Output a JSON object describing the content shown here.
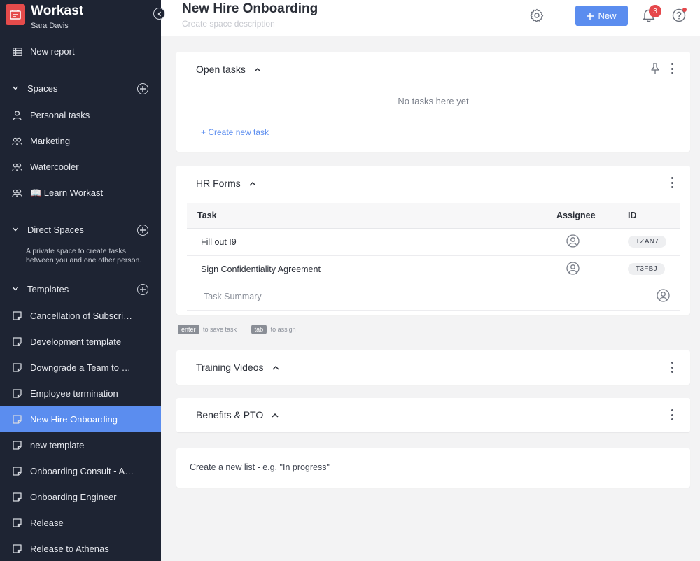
{
  "app": {
    "name": "Workast",
    "user": "Sara Davis"
  },
  "sidebar": {
    "new_report": "New report",
    "spaces": {
      "label": "Spaces",
      "items": [
        {
          "label": "Personal tasks",
          "icon": "person-icon"
        },
        {
          "label": "Marketing",
          "icon": "people-icon"
        },
        {
          "label": "Watercooler",
          "icon": "people-icon"
        },
        {
          "label": "📖 Learn Workast",
          "icon": "people-icon"
        }
      ]
    },
    "direct_spaces": {
      "label": "Direct Spaces",
      "note": "A private space to create tasks between you and one other person."
    },
    "templates": {
      "label": "Templates",
      "items": [
        "Cancellation of Subscription",
        "Development template",
        "Downgrade a Team to Free",
        "Employee termination",
        "New Hire Onboarding",
        "new template",
        "Onboarding Consult - Account",
        "Onboarding Engineer",
        "Release",
        "Release to Athenas"
      ],
      "active": "New Hire Onboarding"
    }
  },
  "header": {
    "title": "New Hire Onboarding",
    "description_placeholder": "Create space description",
    "new_button": "New",
    "notification_count": "3"
  },
  "lists": {
    "open_tasks": {
      "title": "Open tasks",
      "empty": "No tasks here yet",
      "create": "+ Create new task"
    },
    "hr_forms": {
      "title": "HR Forms",
      "columns": {
        "task": "Task",
        "assignee": "Assignee",
        "id": "ID"
      },
      "rows": [
        {
          "task": "Fill out I9",
          "id": "TZAN7"
        },
        {
          "task": "Sign Confidentiality Agreement",
          "id": "T3FBJ"
        }
      ],
      "summary_placeholder": "Task Summary"
    },
    "hints": {
      "enter_key": "enter",
      "enter_text": "to save task",
      "tab_key": "tab",
      "tab_text": "to assign"
    },
    "training_videos": {
      "title": "Training Videos"
    },
    "benefits": {
      "title": "Benefits & PTO"
    },
    "new_list_placeholder": "Create a new list - e.g. \"In progress\""
  },
  "colors": {
    "sidebar_bg": "#1e2433",
    "accent": "#5b8def",
    "logo": "#e54b4b",
    "badge": "#e5474b"
  }
}
